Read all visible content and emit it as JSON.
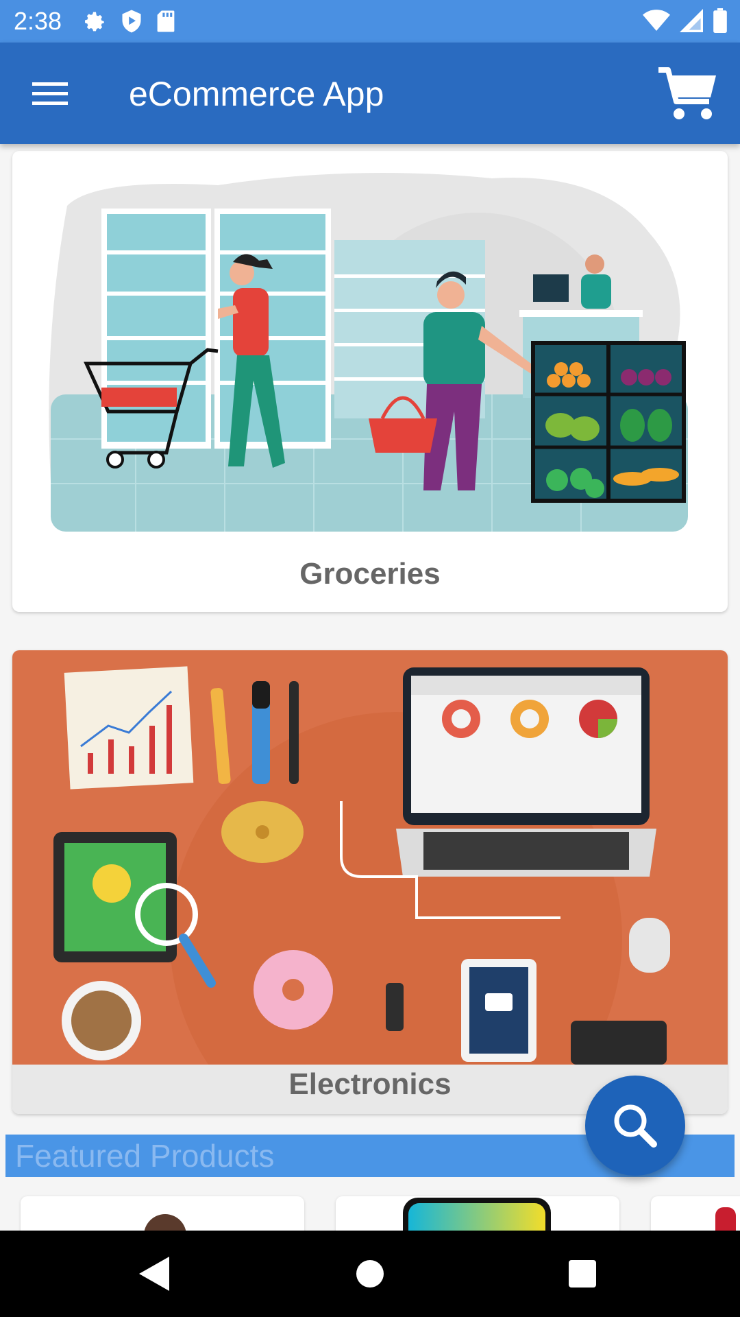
{
  "status_bar": {
    "time": "2:38",
    "left_icons": [
      "gear-icon",
      "shield-play-icon",
      "sd-card-icon"
    ],
    "right_icons": [
      "wifi-icon",
      "signal-icon",
      "battery-icon"
    ]
  },
  "app_bar": {
    "title": "eCommerce App",
    "menu_icon": "hamburger-menu-icon",
    "cart_icon": "shopping-cart-icon"
  },
  "categories": [
    {
      "label": "Groceries"
    },
    {
      "label": "Electronics"
    }
  ],
  "featured": {
    "title": "Featured Products"
  },
  "fab": {
    "icon": "search-icon"
  },
  "nav_bar": {
    "icons": [
      "back-icon",
      "home-icon",
      "recents-icon"
    ]
  },
  "colors": {
    "status_bar": "#4a90e2",
    "app_bar": "#2a6bc0",
    "fab": "#1e63b9",
    "featured_bar": "#4a95e6",
    "electronics_bg": "#d97149"
  }
}
